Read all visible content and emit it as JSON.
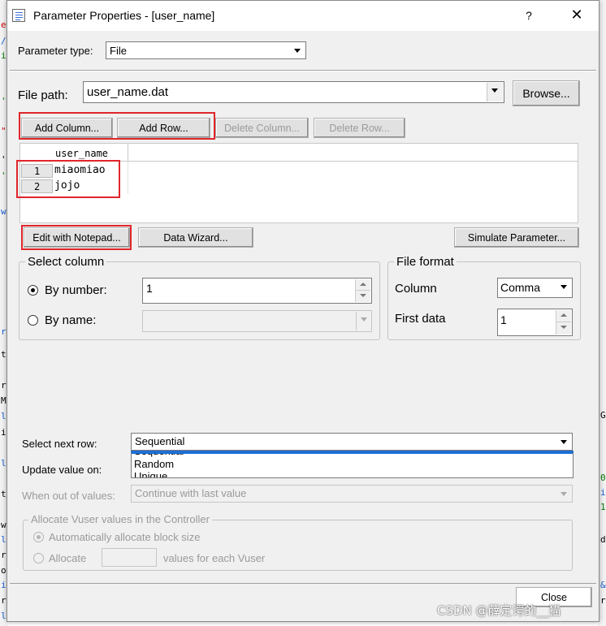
{
  "window": {
    "title": "Parameter Properties - [user_name]",
    "help": "?",
    "close": "✕"
  },
  "param_type": {
    "label": "Parameter type:",
    "value": "File"
  },
  "file_path": {
    "label": "File path:",
    "value": "user_name.dat",
    "browse": "Browse..."
  },
  "table_buttons": {
    "add_column": "Add Column...",
    "add_row": "Add Row...",
    "delete_column": "Delete Column...",
    "delete_row": "Delete Row..."
  },
  "grid": {
    "column_header": "user_name",
    "rows": [
      {
        "num": "1",
        "value": "miaomiao"
      },
      {
        "num": "2",
        "value": "jojo"
      }
    ]
  },
  "action_buttons": {
    "edit_notepad": "Edit with Notepad...",
    "data_wizard": "Data Wizard...",
    "simulate": "Simulate Parameter..."
  },
  "select_column": {
    "title": "Select column",
    "by_number": "By number:",
    "by_number_value": "1",
    "by_name": "By name:"
  },
  "file_format": {
    "title": "File format",
    "column_label": "Column",
    "column_value": "Comma",
    "first_data_label": "First data",
    "first_data_value": "1"
  },
  "next_row": {
    "label": "Select next row:",
    "value": "Sequential",
    "options": [
      "Sequential",
      "Random",
      "Unique"
    ]
  },
  "update_value": {
    "label": "Update value on:"
  },
  "out_of_values": {
    "label": "When out of values:",
    "value": "Continue with last value"
  },
  "allocate": {
    "title": "Allocate Vuser values in the Controller",
    "auto": "Automatically allocate block size",
    "manual": "Allocate",
    "manual_suffix": "values for each Vuser"
  },
  "footer": {
    "close": "Close"
  },
  "watermark": "CSDN @薛定谔的__猫",
  "background_fragments": {
    "left": [
      "e",
      "/",
      "i",
      "'",
      "\"",
      "'",
      "'",
      "w",
      "r",
      "t",
      "r",
      "M",
      "l",
      "i",
      "l",
      "t",
      "w",
      "l",
      "r",
      "o",
      "i",
      "r",
      "l"
    ],
    "right": [
      "G",
      "0",
      "i",
      "1",
      "d",
      "&",
      "r"
    ]
  }
}
